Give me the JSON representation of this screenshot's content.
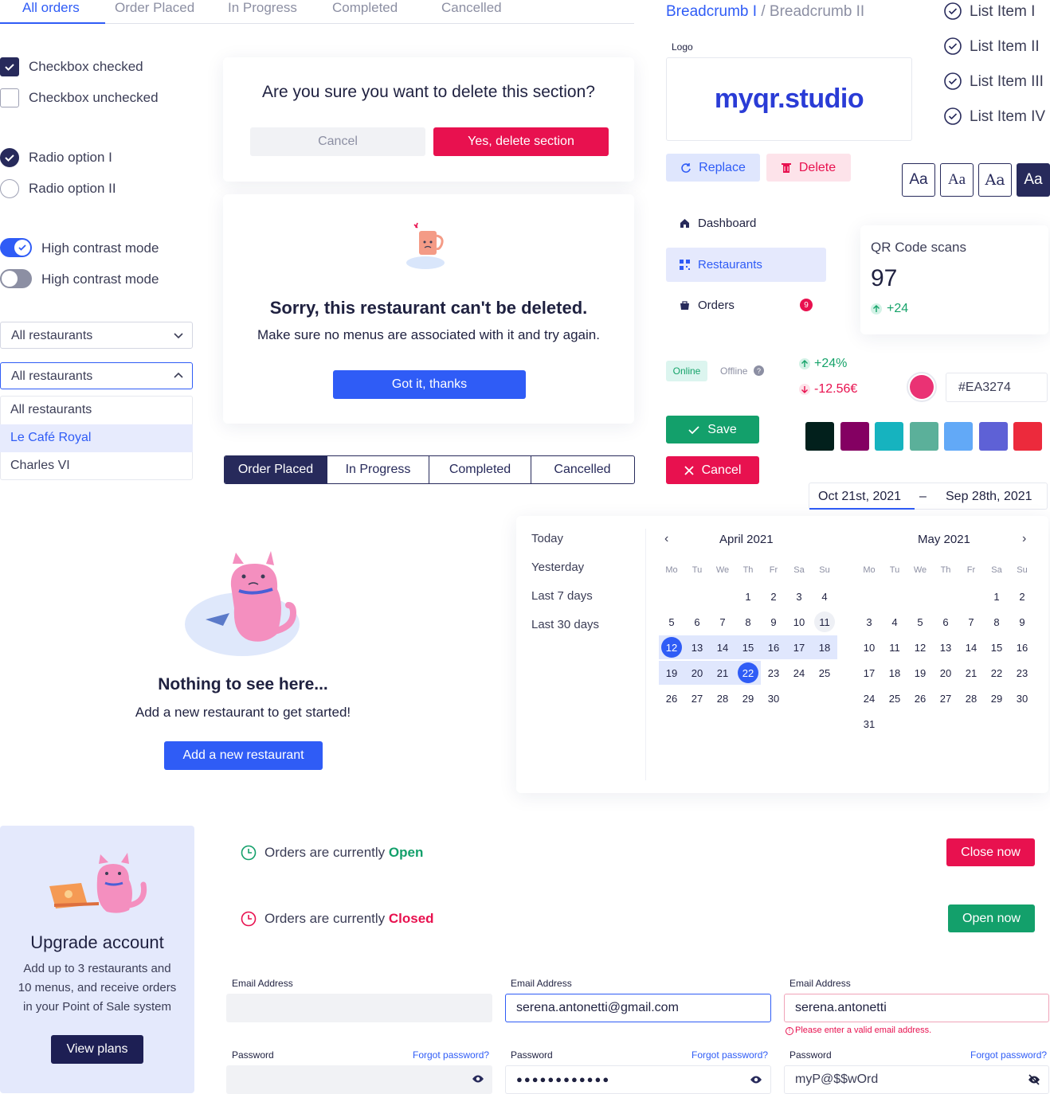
{
  "tabs": [
    "All orders",
    "Order  Placed",
    "In Progress",
    "Completed",
    "Cancelled"
  ],
  "checkboxes": [
    "Checkbox checked",
    "Checkbox unchecked"
  ],
  "radios": [
    "Radio option I",
    "Radio option II"
  ],
  "toggles": [
    "High contrast mode",
    "High contrast mode"
  ],
  "select": {
    "closed_value": "All restaurants",
    "open_value": "All restaurants",
    "options": [
      "All restaurants",
      "Le Café Royal",
      "Charles VI"
    ]
  },
  "delete_dialog": {
    "question": "Are you sure you want to delete this section?",
    "cancel": "Cancel",
    "confirm": "Yes, delete section"
  },
  "error_dialog": {
    "title": "Sorry, this restaurant can't be deleted.",
    "message": "Make sure no menus are associated with it and try again.",
    "button": "Got it, thanks"
  },
  "segmented": [
    "Order Placed",
    "In Progress",
    "Completed",
    "Cancelled"
  ],
  "empty_state": {
    "title": "Nothing to see here...",
    "message": "Add a new restaurant to get started!",
    "button": "Add a new restaurant"
  },
  "breadcrumb": {
    "first": "Breadcrumb I",
    "sep": "/",
    "second": "Breadcrumb II"
  },
  "logo": {
    "label": "Logo",
    "brand": "myqr.studio",
    "replace": "Replace",
    "delete": "Delete"
  },
  "list_items": [
    "List Item I",
    "List Item II",
    "List Item III",
    "List Item IV"
  ],
  "font_samples": [
    "Aa",
    "Aa",
    "Aa",
    "Aa"
  ],
  "nav": {
    "items": [
      "Dashboard",
      "Restaurants",
      "Orders"
    ],
    "orders_badge": "9"
  },
  "stat": {
    "title": "QR Code scans",
    "value": "97",
    "delta": "+24"
  },
  "status": {
    "online": "Online",
    "offline": "Offline"
  },
  "deltas": {
    "up": "+24%",
    "down": "-12.56€"
  },
  "color_picker": {
    "value": "#EA3274",
    "swatch": "#EA3274"
  },
  "swatches": [
    "#02201c",
    "#840062",
    "#16b3bf",
    "#5bb09a",
    "#62a9f7",
    "#5e61d6",
    "#ec2a3c"
  ],
  "actions": {
    "save": "Save",
    "cancel": "Cancel"
  },
  "date_range": {
    "start": "Oct 21st, 2021",
    "sep": "–",
    "end": "Sep 28th, 2021"
  },
  "presets": [
    "Today",
    "Yesterday",
    "Last 7 days",
    "Last 30 days"
  ],
  "calendar": {
    "left_title": "April 2021",
    "right_title": "May 2021",
    "weekdays": [
      "Mo",
      "Tu",
      "We",
      "Th",
      "Fr",
      "Sa",
      "Su"
    ],
    "prev": "‹",
    "next": "›"
  },
  "upgrade": {
    "title": "Upgrade account",
    "line1": "Add up to 3 restaurants and",
    "line2": "10 menus, and receive orders",
    "line3": "in your Point of Sale system",
    "button": "View plans"
  },
  "orders_open": {
    "prefix": "Orders are currently ",
    "state": "Open",
    "button": "Close now"
  },
  "orders_closed": {
    "prefix": "Orders are currently ",
    "state": "Closed",
    "button": "Open now"
  },
  "form": {
    "email_label": "Email Address",
    "password_label": "Password",
    "forgot": "Forgot password?",
    "email_filled": "serena.antonetti@gmail.com",
    "email_invalid": "serena.antonetti",
    "error": "Please enter a valid email address.",
    "password_masked": "●●●●●●●●●●●●",
    "password_shown": "myP@$$wOrd"
  }
}
